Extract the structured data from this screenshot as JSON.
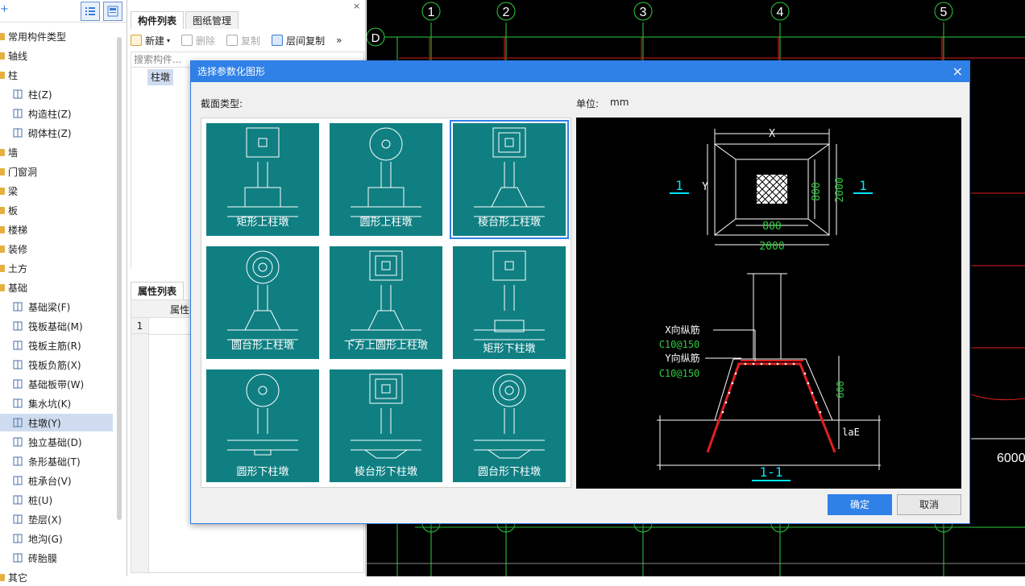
{
  "tree": {
    "plus": "+",
    "items": [
      {
        "label": "常用构件类型",
        "kind": "folder"
      },
      {
        "label": "轴线",
        "kind": "folder"
      },
      {
        "label": "柱",
        "kind": "folder"
      },
      {
        "label": "柱(Z)",
        "kind": "child",
        "icon": "column-icon"
      },
      {
        "label": "构造柱(Z)",
        "kind": "child",
        "icon": "constructional-column-icon"
      },
      {
        "label": "砌体柱(Z)",
        "kind": "child",
        "icon": "masonry-column-icon"
      },
      {
        "label": "墙",
        "kind": "folder"
      },
      {
        "label": "门窗洞",
        "kind": "folder"
      },
      {
        "label": "梁",
        "kind": "folder"
      },
      {
        "label": "板",
        "kind": "folder"
      },
      {
        "label": "楼梯",
        "kind": "folder"
      },
      {
        "label": "装修",
        "kind": "folder"
      },
      {
        "label": "土方",
        "kind": "folder"
      },
      {
        "label": "基础",
        "kind": "folder"
      },
      {
        "label": "基础梁(F)",
        "kind": "child",
        "icon": "foundation-beam-icon"
      },
      {
        "label": "筏板基础(M)",
        "kind": "child",
        "icon": "raft-foundation-icon"
      },
      {
        "label": "筏板主筋(R)",
        "kind": "child",
        "icon": "raft-main-rebar-icon"
      },
      {
        "label": "筏板负筋(X)",
        "kind": "child",
        "icon": "raft-negative-rebar-icon"
      },
      {
        "label": "基础板带(W)",
        "kind": "child",
        "icon": "foundation-strip-icon"
      },
      {
        "label": "集水坑(K)",
        "kind": "child",
        "icon": "sump-pit-icon"
      },
      {
        "label": "柱墩(Y)",
        "kind": "child",
        "icon": "column-pier-icon",
        "selected": true
      },
      {
        "label": "独立基础(D)",
        "kind": "child",
        "icon": "isolated-footing-icon"
      },
      {
        "label": "条形基础(T)",
        "kind": "child",
        "icon": "strip-footing-icon"
      },
      {
        "label": "桩承台(V)",
        "kind": "child",
        "icon": "pile-cap-icon"
      },
      {
        "label": "桩(U)",
        "kind": "child",
        "icon": "pile-icon"
      },
      {
        "label": "垫层(X)",
        "kind": "child",
        "icon": "cushion-layer-icon"
      },
      {
        "label": "地沟(G)",
        "kind": "child",
        "icon": "trench-icon"
      },
      {
        "label": "砖胎膜",
        "kind": "child",
        "icon": "brick-mold-icon"
      },
      {
        "label": "其它",
        "kind": "folder"
      }
    ]
  },
  "mid": {
    "close": "×",
    "tabs": [
      "构件列表",
      "图纸管理"
    ],
    "toolbar": {
      "new": "新建",
      "delete": "删除",
      "copy": "复制",
      "floor_copy": "层间复制",
      "more": "»"
    },
    "search_placeholder": "搜索构件...",
    "list_item": "柱墩",
    "prop_tab": "属性列表",
    "prop_header": "属性",
    "prop_row_num": "1"
  },
  "cad": {
    "axes": [
      "1",
      "2",
      "3",
      "4",
      "5"
    ],
    "row_axis": "D",
    "dimension": "6000"
  },
  "dialog": {
    "title": "选择参数化图形",
    "close": "×",
    "section_type_label": "截面类型:",
    "unit_label": "单位:",
    "unit_value": "mm",
    "shapes": [
      "矩形上柱墩",
      "圆形上柱墩",
      "棱台形上柱墩",
      "圆台形上柱墩",
      "下方上圆形上柱墩",
      "矩形下柱墩",
      "圆形下柱墩",
      "棱台形下柱墩",
      "圆台形下柱墩"
    ],
    "selected_index": 2,
    "preview": {
      "x_label": "X",
      "y_label": "Y",
      "dim_800_h": "800",
      "dim_800_v": "800",
      "dim_2000_h": "2000",
      "dim_2000_v": "2000",
      "section_mark": "1",
      "x_rebar": "X向纵筋",
      "x_rebar_spec": "C10@150",
      "y_rebar": "Y向纵筋",
      "y_rebar_spec": "C10@150",
      "dim_600": "600",
      "lae": "laE",
      "section_title": "1-1"
    },
    "ok": "确定",
    "cancel": "取消"
  },
  "colors": {
    "accent": "#2f80e7",
    "tile": "#0f7f82",
    "cad_green": "#2ecc40",
    "cad_red": "#e02020",
    "cad_cyan": "#00e5ff"
  }
}
